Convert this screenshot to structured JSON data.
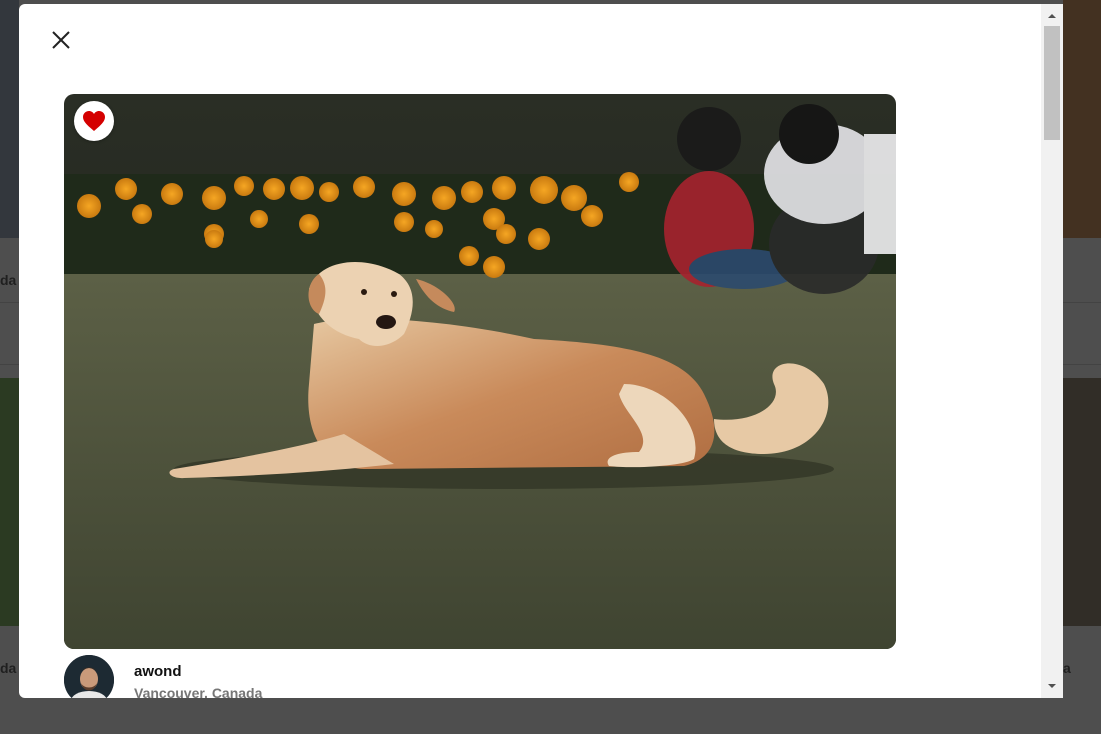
{
  "background": {
    "left_labels": [
      "da",
      "da"
    ],
    "right_label": "a"
  },
  "modal": {
    "photo": {
      "alt": "Dog lying on grass",
      "liked": true
    },
    "author": {
      "name": "awond",
      "location": "Vancouver, Canada"
    }
  },
  "colors": {
    "like_heart": "#d40000",
    "overlay": "#8f8f8f"
  },
  "icons": {
    "close": "close-icon",
    "like": "heart-icon",
    "scroll_up": "chevron-up-icon",
    "scroll_down": "chevron-down-icon"
  }
}
